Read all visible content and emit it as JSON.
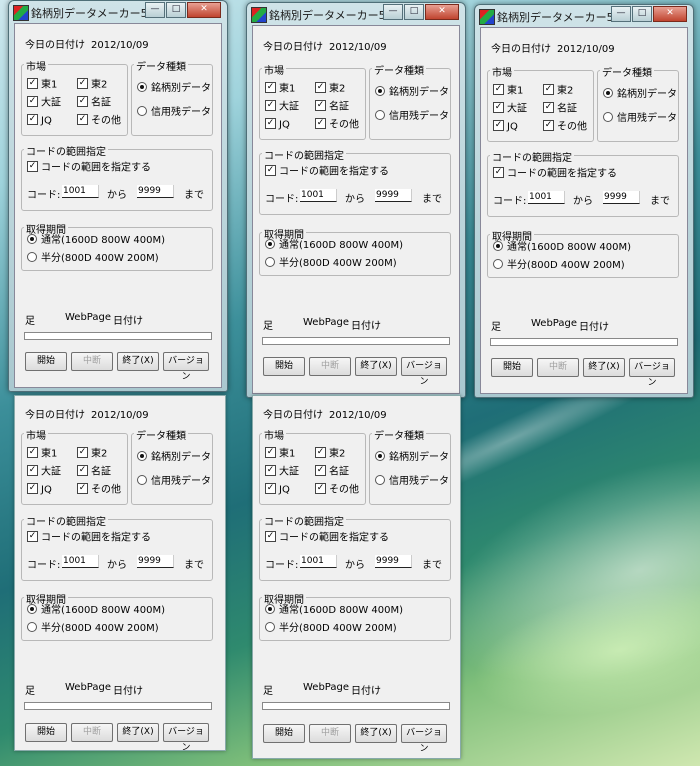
{
  "app": {
    "title": "銘柄別データメーカー5",
    "window_buttons": {
      "minimize": "—",
      "maximize": "□",
      "close": "✕"
    },
    "app_icon": "chart-app-icon"
  },
  "form": {
    "date_label": "今日の日付け",
    "date_value": "2012/10/09",
    "market": {
      "title": "市場",
      "items": [
        {
          "label": "東1",
          "checked": true
        },
        {
          "label": "東2",
          "checked": true
        },
        {
          "label": "大証",
          "checked": true
        },
        {
          "label": "名証",
          "checked": true
        },
        {
          "label": "JQ",
          "checked": true
        },
        {
          "label": "その他",
          "checked": true
        }
      ]
    },
    "data_type": {
      "title": "データ種類",
      "options": [
        {
          "label": "銘柄別データ",
          "selected": true
        },
        {
          "label": "信用残データ",
          "selected": false
        }
      ]
    },
    "code_range": {
      "title": "コードの範囲指定",
      "enable_label": "コードの範囲を指定する",
      "enabled": true,
      "code_label": "コード:",
      "from_value": "1001",
      "from_label": "から",
      "to_value": "9999",
      "to_label": "まで"
    },
    "period": {
      "title": "取得期間",
      "options": [
        {
          "label": "通常(1600D 800W 400M)",
          "selected": true
        },
        {
          "label": "半分(800D 400W 200M)",
          "selected": false
        }
      ]
    },
    "status": {
      "ashi": "足",
      "webpage": "WebPage",
      "date": "日付け"
    },
    "progress": 0,
    "buttons": {
      "start": "開始",
      "interrupt": "中断",
      "exit": "終了(X)",
      "version": "バージョン"
    }
  }
}
